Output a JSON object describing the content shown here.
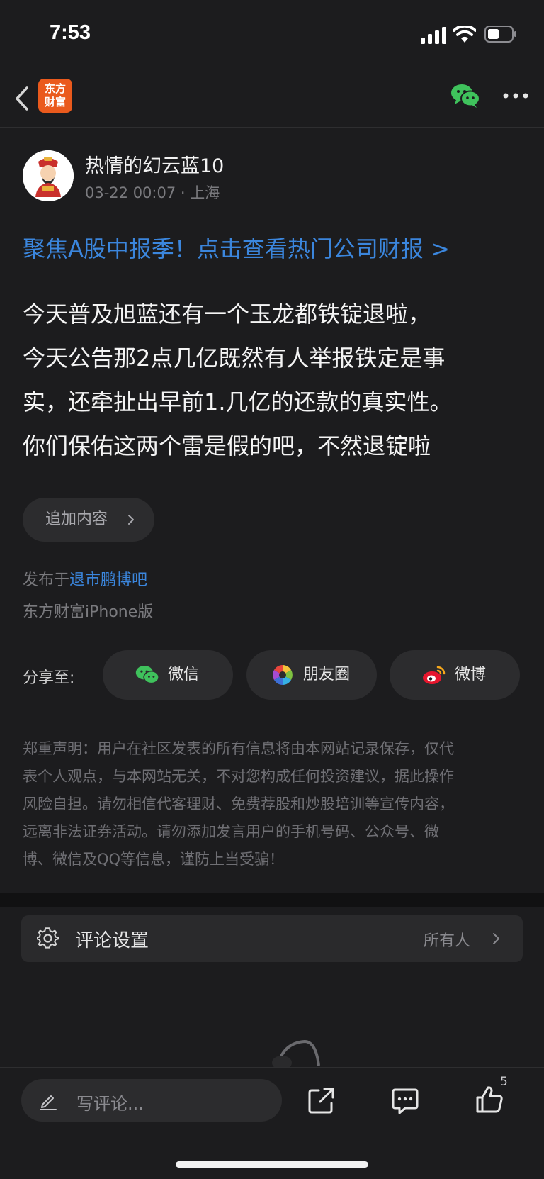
{
  "status_bar": {
    "time": "7:53"
  },
  "nav": {
    "brand_logo_text_line1": "东方",
    "brand_logo_text_line2": "财富"
  },
  "author": {
    "name": "热情的幻云蓝10",
    "meta": "03-22 00:07 · 上海"
  },
  "promo": {
    "text": "聚焦A股中报季！点击查看热门公司财报 >"
  },
  "post": {
    "lines": [
      "今天普及旭蓝还有一个玉龙都铁锭退啦，",
      "今天公告那2点几亿既然有人举报铁定是事",
      "实，还牵扯出早前1.几亿的还款的真实性。",
      "你们保佑这两个雷是假的吧，不然退锭啦"
    ]
  },
  "append_button": {
    "label": "追加内容"
  },
  "published": {
    "prefix": "发布于",
    "forum": "退市鹏博吧"
  },
  "device": {
    "text": "东方财富iPhone版"
  },
  "share": {
    "label": "分享至:",
    "buttons": [
      {
        "label": "微信",
        "icon": "wechat-icon"
      },
      {
        "label": "朋友圈",
        "icon": "moments-icon"
      },
      {
        "label": "微博",
        "icon": "weibo-icon"
      }
    ]
  },
  "disclaimer": {
    "lines": [
      "郑重声明：用户在社区发表的所有信息将由本网站记录保存，仅代",
      "表个人观点，与本网站无关，不对您构成任何投资建议，据此操作",
      "风险自担。请勿相信代客理财、免费荐股和炒股培训等宣传内容，",
      "远离非法证券活动。请勿添加发言用户的手机号码、公众号、微",
      "博、微信及QQ等信息，谨防上当受骗！"
    ]
  },
  "comment_settings": {
    "label": "评论设置",
    "value": "所有人"
  },
  "bottom_bar": {
    "comment_placeholder": "写评论...",
    "like_count": "5"
  },
  "colors": {
    "background": "#1c1c1e",
    "link_blue": "#3b86dd",
    "brand_orange": "#ea5a1d",
    "wechat_green": "#3fc25c"
  }
}
